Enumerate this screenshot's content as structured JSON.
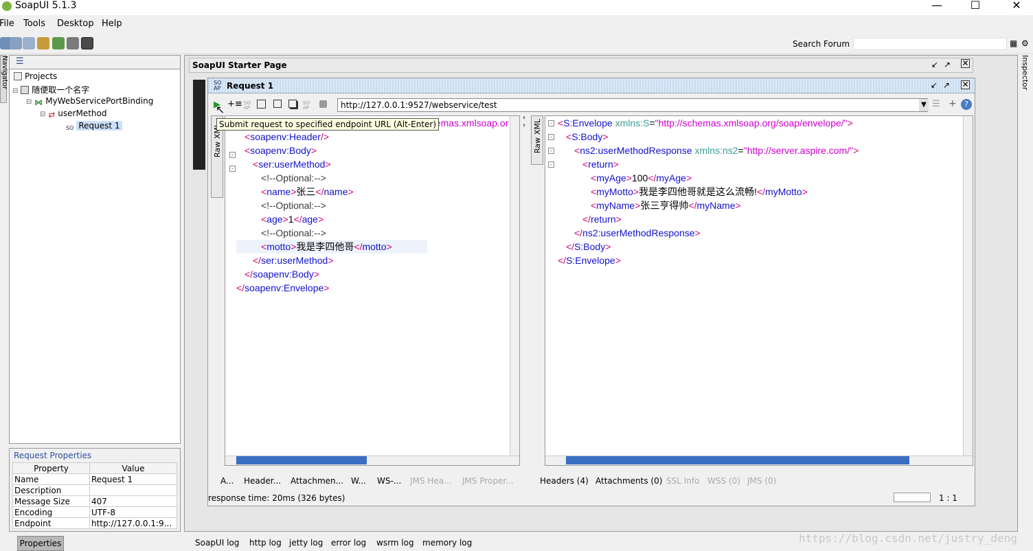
{
  "window": {
    "title": "SoapUI 5.1.3"
  },
  "menu": [
    "File",
    "Tools",
    "Desktop",
    "Help"
  ],
  "search": {
    "label": "Search Forum",
    "value": ""
  },
  "side_tabs": {
    "navigator": "Navigator",
    "inspector": "Inspector"
  },
  "tree": {
    "root": "Projects",
    "project": "随便取一个名字",
    "interface": "MyWebServicePortBinding",
    "operation": "userMethod",
    "request": "Request 1"
  },
  "properties": {
    "title": "Request Properties",
    "headers": [
      "Property",
      "Value"
    ],
    "rows": [
      [
        "Name",
        "Request 1"
      ],
      [
        "Description",
        ""
      ],
      [
        "Message Size",
        "407"
      ],
      [
        "Encoding",
        "UTF-8"
      ],
      [
        "Endpoint",
        "http://127.0.0.1:9..."
      ]
    ],
    "tab": "Properties"
  },
  "starter": {
    "title": "SoapUI Starter Page"
  },
  "request": {
    "title": "Request 1",
    "url": "http://127.0.0.1:9527/webservice/test",
    "tooltip": "Submit request to specified endpoint URL (Alt-Enter)",
    "left_tabs": [
      "XML",
      "Raw"
    ],
    "right_tabs": [
      "XML",
      "Raw"
    ],
    "request_bottom_tabs": [
      "A...",
      "Header...",
      "Attachmen...",
      "W...",
      "WS-..."
    ],
    "request_bottom_tabs_disabled": [
      "JMS Hea...",
      "JMS Proper..."
    ],
    "response_bottom_tabs": [
      "Headers (4)",
      "Attachments (0)"
    ],
    "response_bottom_tabs_disabled": [
      "SSL Info",
      "WSS (0)",
      "JMS (0)"
    ],
    "status": "response time: 20ms (326 bytes)",
    "position": "1 : 1"
  },
  "req_xml": {
    "l0_hidden": "hemas.xmlsoap.or",
    "l1": "soapenv:Header",
    "l2": "soapenv:Body",
    "l3": "ser:userMethod",
    "c1": "<!--Optional:-->",
    "name_tag": "name",
    "name_val": "张三",
    "c2": "<!--Optional:-->",
    "age_tag": "age",
    "age_val": "1",
    "c3": "<!--Optional:-->",
    "motto_tag": "motto",
    "motto_val": "我是李四他哥",
    "l3_close": "ser:userMethod",
    "l2_close": "soapenv:Body",
    "l1_close": "soapenv:Envelope"
  },
  "resp_xml": {
    "env": "S:Envelope",
    "env_attr": "xmlns:S",
    "env_val": "\"http://schemas.xmlsoap.org/soap/envelope/\"",
    "body": "S:Body",
    "resp": "ns2:userMethodResponse",
    "resp_attr": "xmlns:ns2",
    "resp_val": "\"http://server.aspire.com/\"",
    "ret": "return",
    "age_tag": "myAge",
    "age_val": "100",
    "motto_tag": "myMotto",
    "motto_val": "我是李四他哥就是这么流畅!",
    "name_tag": "myName",
    "name_val": "张三亨得帅",
    "ret_close": "return",
    "resp_close": "ns2:userMethodResponse",
    "body_close": "S:Body",
    "env_close": "S:Envelope"
  },
  "logs": [
    "SoapUI log",
    "http log",
    "jetty log",
    "error log",
    "wsrm log",
    "memory log"
  ],
  "watermark": "https://blog.csdn.net/justry_deng"
}
